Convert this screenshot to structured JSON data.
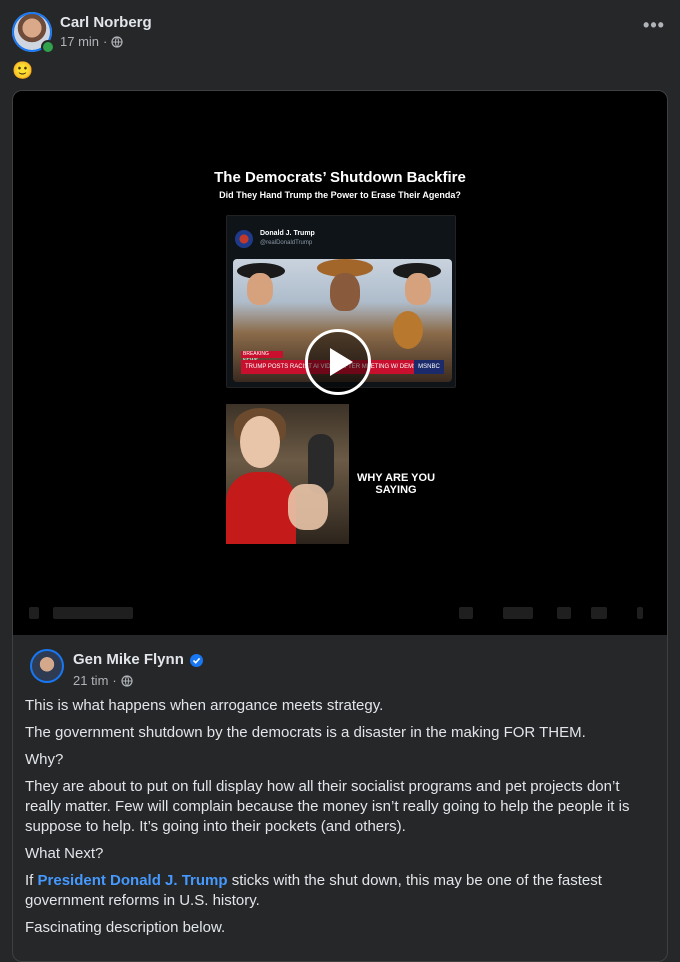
{
  "post": {
    "author": "Carl Norberg",
    "time": "17 min",
    "separator": "·",
    "emoji": "🙂",
    "more_icon": "more-horizontal-icon"
  },
  "video": {
    "title": "The Democrats’ Shutdown Backfire",
    "subtitle": "Did They Hand Trump the Power to Erase Their Agenda?",
    "tweet_name": "Donald J. Trump",
    "tweet_handle": "@realDonaldTrump",
    "breaking": "BREAKING NEWS",
    "ticker": "TRUMP POSTS RACIST AI VIDEO AFTER MEETING W/ DEMS",
    "network": "MSNBC",
    "caption": "WHY ARE YOU SAYING"
  },
  "shared": {
    "author": "Gen Mike Flynn",
    "time": "21 tim",
    "separator": "·",
    "paragraphs": [
      "This is what happens when arrogance meets strategy.",
      "The government shutdown by the democrats is a disaster in the making FOR THEM.",
      "Why?",
      "They are about to put on full display how all their socialist programs and pet projects don’t really matter. Few will complain because the money isn’t really going to help the people it is suppose to help. It’s going into their pockets (and others).",
      "What Next?"
    ],
    "p6_pre": "If ",
    "p6_link": "President Donald J. Trump",
    "p6_post": " sticks with the shut down, this may be one of the fastest government reforms in U.S. history.",
    "p7": "Fascinating description below."
  },
  "colors": {
    "background": "#252728",
    "link": "#4599ff",
    "verified": "#1877f2",
    "online": "#31a24c"
  }
}
